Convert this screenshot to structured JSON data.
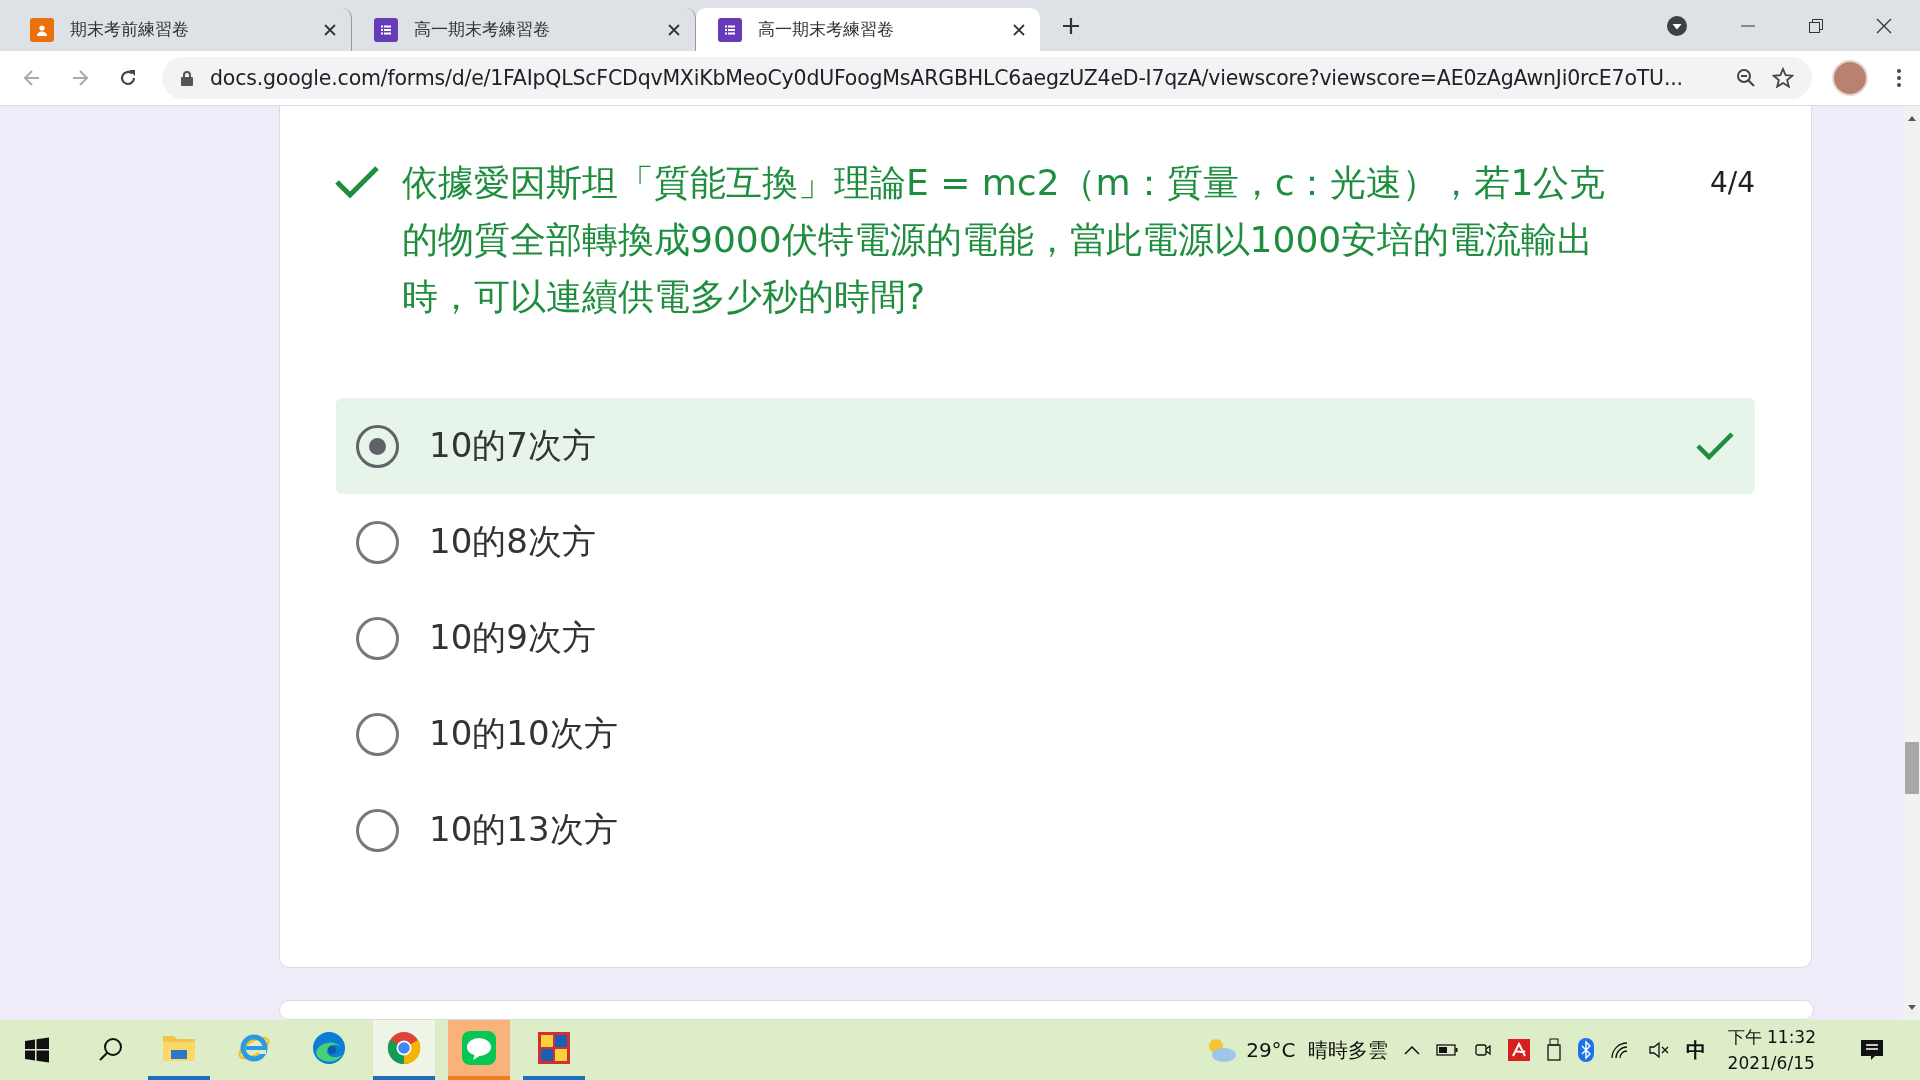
{
  "tabs": [
    {
      "title": "期末考前練習卷",
      "kind": "person",
      "selected": false
    },
    {
      "title": "高一期末考練習卷",
      "kind": "form",
      "selected": false
    },
    {
      "title": "高一期末考練習卷",
      "kind": "form",
      "selected": true
    }
  ],
  "address_bar": {
    "url": "docs.google.com/forms/d/e/1FAIpQLScFCDqvMXiKbMeoCy0dUFoogMsARGBHLC6aegzUZ4eD-I7qzA/viewscore?viewscore=AE0zAgAwnJi0rcE7oTU..."
  },
  "question": {
    "correct": true,
    "text": "依據愛因斯坦「質能互換」理論E = mc2（m：質量，c：光速），若1公克的物質全部轉換成9000伏特電源的電能，當此電源以1000安培的電流輸出時，可以連續供電多少秒的時間?",
    "score": "4/4",
    "options": [
      {
        "label": "10的7次方",
        "selected": true,
        "correct": true
      },
      {
        "label": "10的8次方",
        "selected": false,
        "correct": false
      },
      {
        "label": "10的9次方",
        "selected": false,
        "correct": false
      },
      {
        "label": "10的10次方",
        "selected": false,
        "correct": false
      },
      {
        "label": "10的13次方",
        "selected": false,
        "correct": false
      }
    ]
  },
  "taskbar": {
    "apps": [
      {
        "kind": "files",
        "running": true,
        "active": false,
        "alert": false
      },
      {
        "kind": "ie",
        "running": false,
        "active": false,
        "alert": false
      },
      {
        "kind": "edge",
        "running": false,
        "active": false,
        "alert": false
      },
      {
        "kind": "chrome",
        "running": true,
        "active": true,
        "alert": false
      },
      {
        "kind": "line",
        "running": true,
        "active": false,
        "alert": true
      },
      {
        "kind": "exam",
        "running": true,
        "active": false,
        "alert": false
      }
    ],
    "temperature": "29°C",
    "weather": "晴時多雲",
    "ime": "中",
    "time": "下午 11:32",
    "date": "2021/6/15"
  }
}
